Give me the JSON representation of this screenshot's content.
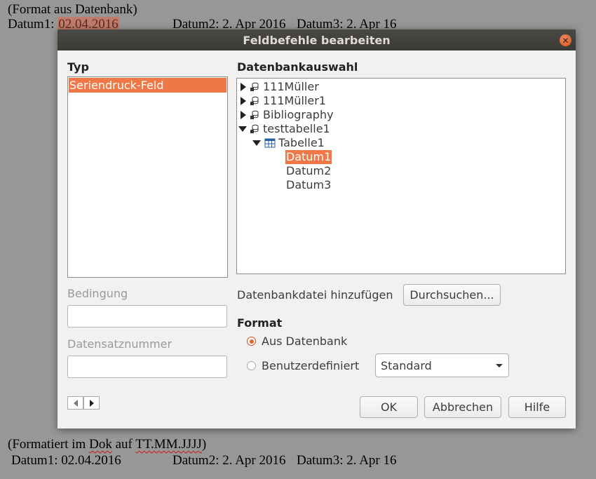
{
  "document": {
    "top_note": "(Format aus Datenbank)",
    "top_d1_label": "Datum1:",
    "top_d1_value": "02.04.2016",
    "top_d2": "Datum2: 2. Apr 2016",
    "top_d3": "Datum3: 2. Apr 16",
    "bottom_note_prefix": "(Formatiert im ",
    "bottom_note_dok": "Dok",
    "bottom_note_mid": " auf ",
    "bottom_note_fmt": "TT.MM.JJJJ",
    "bottom_note_suffix": ")",
    "bottom_d1": "Datum1: 02.04.2016",
    "bottom_d2": "Datum2: 2. Apr 2016",
    "bottom_d3": "Datum3: 2. Apr 16"
  },
  "dialog": {
    "title": "Feldbefehle bearbeiten",
    "close_glyph": "✕",
    "typ_label": "Typ",
    "typ_items": [
      "Seriendruck-Feld"
    ],
    "db_label": "Datenbankauswahl",
    "tree": [
      {
        "label": "111Müller",
        "expander": "collapsed",
        "icon": "database-icon"
      },
      {
        "label": "111Müller1",
        "expander": "collapsed",
        "icon": "database-icon"
      },
      {
        "label": "Bibliography",
        "expander": "collapsed",
        "icon": "database-icon"
      },
      {
        "label": "testtabelle1",
        "expander": "expanded",
        "icon": "database-icon"
      },
      {
        "label": "Tabelle1",
        "expander": "expanded",
        "icon": "table-icon"
      },
      {
        "label": "Datum1",
        "selected": true
      },
      {
        "label": "Datum2"
      },
      {
        "label": "Datum3"
      }
    ],
    "bedingung_label": "Bedingung",
    "bedingung_value": "",
    "datensatznummer_label": "Datensatznummer",
    "datensatznummer_value": "",
    "add_db_label": "Datenbankdatei hinzufügen",
    "browse_button": "Durchsuchen...",
    "format_label": "Format",
    "radio_from_db": "Aus Datenbank",
    "radio_from_db_checked": true,
    "radio_custom": "Benutzerdefiniert",
    "radio_custom_checked": false,
    "format_select_value": "Standard",
    "ok_button": "OK",
    "cancel_button": "Abbrechen",
    "help_button": "Hilfe"
  },
  "colors": {
    "background": "#979797",
    "accent": "#f07746",
    "titlebar": "#3b3a37",
    "dialog_bg": "#f2f1f0"
  }
}
